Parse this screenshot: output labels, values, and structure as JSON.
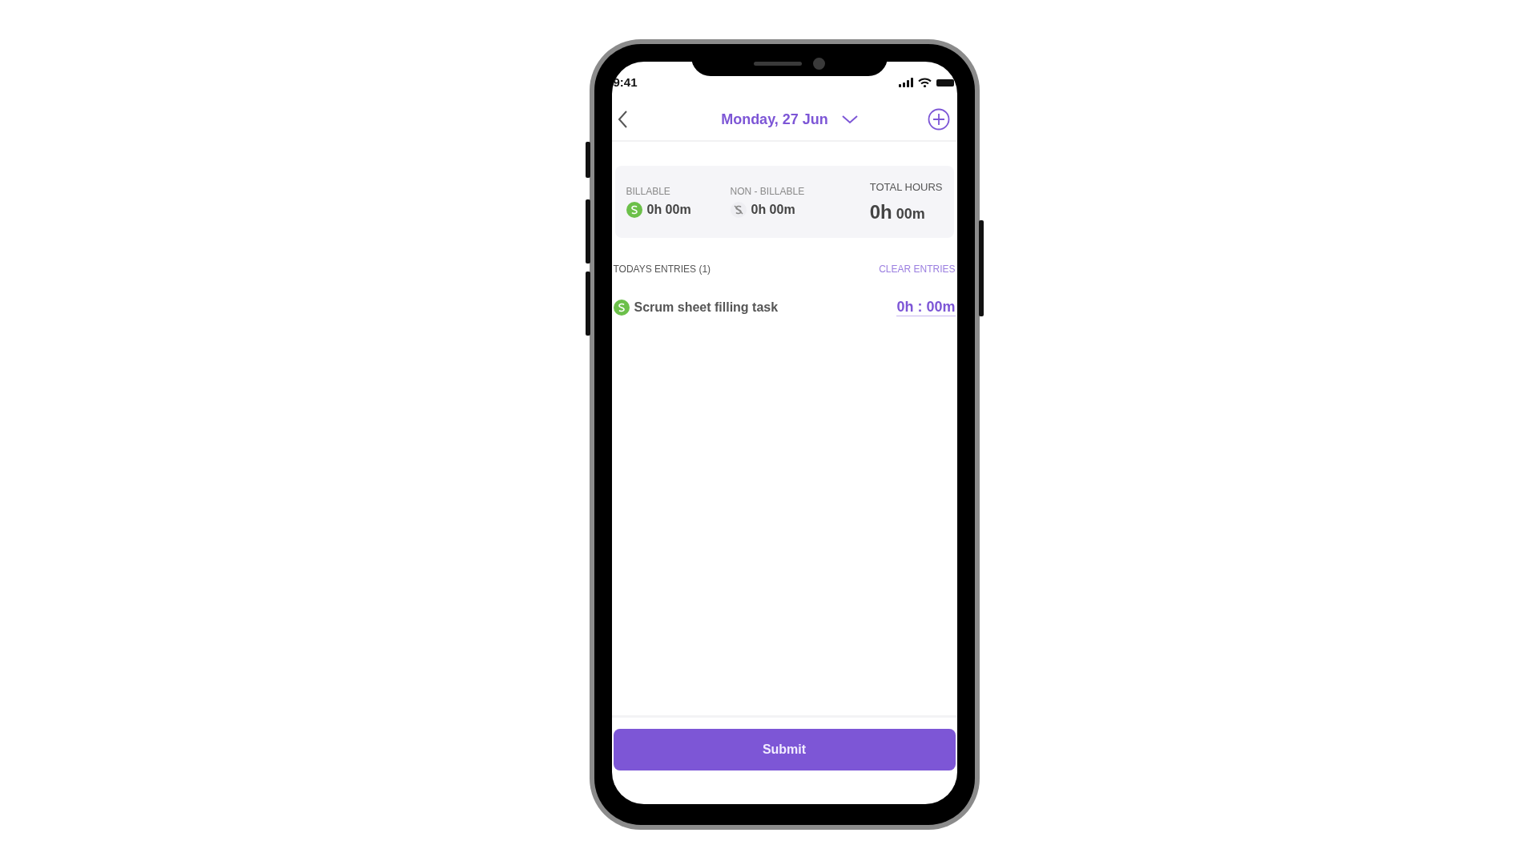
{
  "status_bar": {
    "time": "9:41"
  },
  "header": {
    "title": "Monday, 27 Jun"
  },
  "summary": {
    "items": [
      {
        "label": "BILLABLE",
        "value": "0h 00m",
        "billable": true
      },
      {
        "label": "NON - BILLABLE",
        "value": "0h 00m",
        "billable": false
      }
    ],
    "total": {
      "label": "TOTAL HOURS",
      "hours": "0h",
      "minutes": "00m"
    }
  },
  "entries_header": {
    "title": "TODAYS ENTRIES (1)",
    "action": "CLEAR ENTRIES"
  },
  "entries": [
    {
      "name": "Scrum sheet filling task",
      "duration": "0h : 00m",
      "billable": true
    }
  ],
  "submit": "Submit"
}
